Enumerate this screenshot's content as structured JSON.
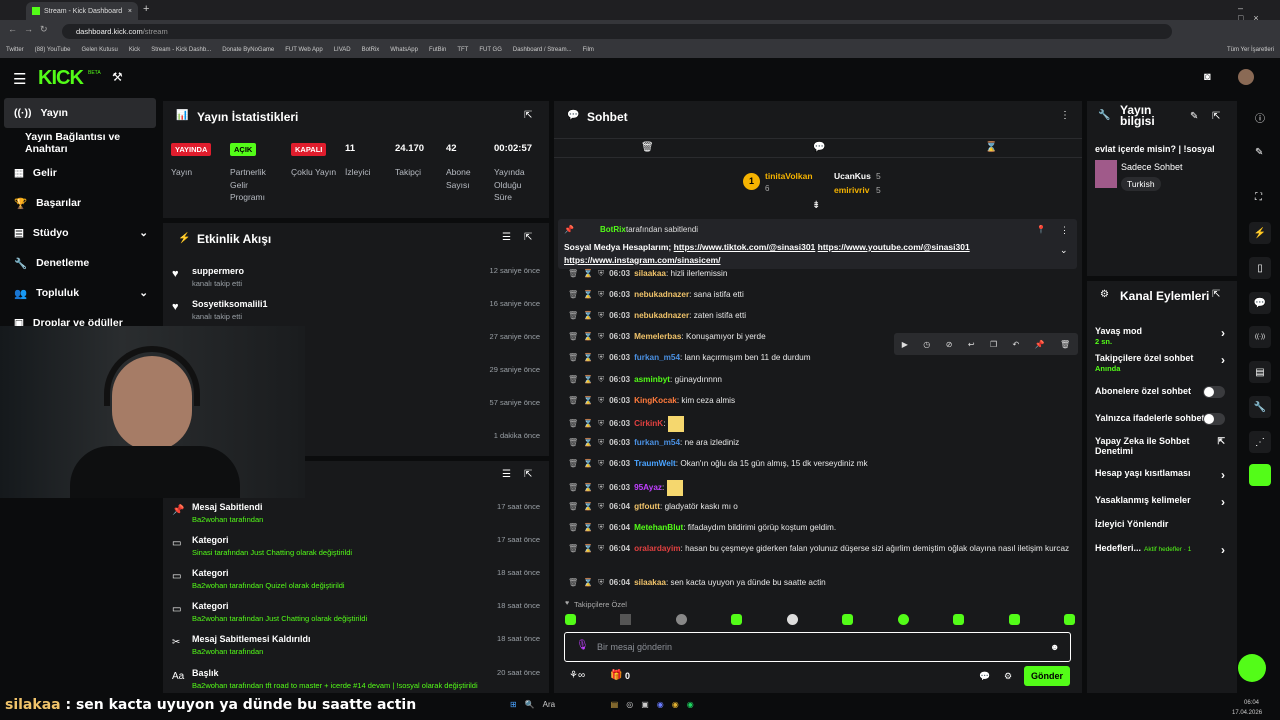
{
  "browser": {
    "tab_title": "Stream - Kick Dashboard",
    "url_host": "dashboard.kick.com",
    "url_path": "/stream",
    "bookmarks": [
      "Twitter",
      "(88) YouTube",
      "Gelen Kutusu",
      "Kick",
      "Stream - Kick Dashb...",
      "Donate ByNoGame",
      "FUT Web App",
      "LIVAD",
      "BotRix",
      "WhatsApp",
      "FutBin",
      "TFT",
      "FUT GG",
      "Dashboard / Stream...",
      "Film"
    ],
    "all_bookmarks": "Tüm Yer İşaretleri"
  },
  "logo": "KICK",
  "logo_sup": "BETA",
  "sidebar": {
    "items": [
      {
        "label": "Yayın",
        "icon": "broadcast-icon"
      },
      {
        "label": "Yayın Bağlantısı ve Anahtarı"
      },
      {
        "label": "Gelir",
        "icon": "chart-icon"
      },
      {
        "label": "Başarılar",
        "icon": "trophy-icon"
      },
      {
        "label": "Stüdyo",
        "icon": "grid-icon"
      },
      {
        "label": "Denetleme",
        "icon": "wrench-icon"
      },
      {
        "label": "Topluluk",
        "icon": "people-icon"
      },
      {
        "label": "Droplar ve ödüller",
        "icon": "drops-icon"
      }
    ]
  },
  "stats": {
    "title": "Yayın İstatistikleri",
    "items": [
      {
        "badge": "YAYINDA",
        "badge_color": "#e01d2d",
        "label": "Yayın"
      },
      {
        "badge": "AÇIK",
        "badge_color": "#53fc18",
        "label": "Partnerlik Gelir Programı"
      },
      {
        "badge": "KAPALI",
        "badge_color": "#e01d2d",
        "label": "Çoklu Yayın"
      },
      {
        "value": "11",
        "label": "İzleyici"
      },
      {
        "value": "24.170",
        "label": "Takipçi"
      },
      {
        "value": "42",
        "label": "Abone Sayısı"
      },
      {
        "value": "00:02:57",
        "label": "Yayında Olduğu Süre"
      }
    ]
  },
  "activity": {
    "title": "Etkinlik Akışı",
    "items": [
      {
        "name": "suppermero",
        "sub": "kanalı takip etti",
        "time": "12 saniye önce"
      },
      {
        "name": "Sosyetiksomalili1",
        "sub": "kanalı takip etti",
        "time": "16 saniye önce"
      },
      {
        "time": "27 saniye önce"
      },
      {
        "time": "29 saniye önce"
      },
      {
        "time": "57 saniye önce"
      },
      {
        "time": "1 dakika önce"
      }
    ]
  },
  "modlog": {
    "items": [
      {
        "title": "Mesaj Sabitlendi",
        "sub": "Ba2wohan tarafından",
        "time": "17 saat önce"
      },
      {
        "title": "Kategori",
        "sub": "Sinasi tarafından Just Chatting olarak değiştirildi",
        "time": "17 saat önce"
      },
      {
        "title": "Kategori",
        "sub": "Ba2wohan tarafından Quizel olarak değiştirildi",
        "time": "18 saat önce"
      },
      {
        "title": "Kategori",
        "sub": "Ba2wohan tarafından Just Chatting olarak değiştirildi",
        "time": "18 saat önce"
      },
      {
        "title": "Mesaj Sabitlemesi Kaldırıldı",
        "sub": "Ba2wohan tarafından",
        "time": "18 saat önce"
      },
      {
        "title": "Başlık",
        "sub": "Ba2wohan tarafından tft road to master + icerde #14 devam | !sosyal olarak değiştirildi",
        "time": "20 saat önce"
      }
    ]
  },
  "chat": {
    "title": "Sohbet",
    "leaders": [
      {
        "name": "tinitaVolkan",
        "count": "6",
        "rank": "1"
      },
      {
        "name": "UcanKus",
        "count": "5"
      },
      {
        "name": "emirivriv",
        "count": "5"
      }
    ],
    "pinned": {
      "by": "BotRix",
      "by_suffix": "tarafından sabitlendi",
      "text": "Sosyal Medya Hesaplarım;",
      "links": [
        "https://www.tiktok.com/@sinasi301",
        "https://www.youtube.com/@sinasi301",
        "https://www.instagram.com/sinasicem/"
      ]
    },
    "messages": [
      {
        "time": "06:03",
        "user": "silaakaa",
        "color": "#f0c36a",
        "text": "hizli ilerlemissin"
      },
      {
        "time": "06:03",
        "user": "nebukadnazer",
        "color": "#f0c36a",
        "text": "sana istifa etti"
      },
      {
        "time": "06:03",
        "user": "nebukadnazer",
        "color": "#f0c36a",
        "text": "zaten istifa etti"
      },
      {
        "time": "06:03",
        "user": "Memelerbas",
        "color": "#f0c36a",
        "text": "Konuşamıyor bi yerde"
      },
      {
        "time": "06:03",
        "user": "furkan_m54",
        "color": "#4a90e2",
        "text": "lann kaçırmışım ben 11 de durdum"
      },
      {
        "time": "06:03",
        "user": "asminbyt",
        "color": "#53fc18",
        "text": "günaydınnnn"
      },
      {
        "time": "06:03",
        "user": "KingKocak",
        "color": "#ff7a3c",
        "text": "kim ceza almis"
      },
      {
        "time": "06:03",
        "user": "CirkinK",
        "color": "#e04040",
        "text": ""
      },
      {
        "time": "06:03",
        "user": "furkan_m54",
        "color": "#4a90e2",
        "text": "ne ara izlediniz"
      },
      {
        "time": "06:03",
        "user": "TraumWelt",
        "color": "#4aa3ff",
        "text": "Okan'ın oğlu da 15 gün almış, 15 dk verseydiniz mk"
      },
      {
        "time": "06:03",
        "user": "95Ayaz",
        "color": "#c040ff",
        "text": ""
      },
      {
        "time": "06:04",
        "user": "gtfoutt",
        "color": "#f0c36a",
        "text": "gladyatör kaskı mı o"
      },
      {
        "time": "06:04",
        "user": "MetehanBlut",
        "color": "#53fc18",
        "text": "fifadaydım bildirimi görüp koştum geldim."
      },
      {
        "time": "06:04",
        "user": "oralardayim",
        "color": "#e04040",
        "text": "hasan bu çeşmeye giderken falan yolunuz düşerse sizi ağırlim demiştim oğlak olayına nasıl iletişim kurcaz"
      },
      {
        "time": "06:04",
        "user": "silaakaa",
        "color": "#f0c36a",
        "text": "sen kacta uyuyon ya dünde bu saatte actin"
      }
    ],
    "follower_only": "Takipçilere Özel",
    "placeholder": "Bir mesaj gönderin",
    "send_label": "Gönder",
    "count": "0"
  },
  "stream_info": {
    "title": "Yayın bilgisi",
    "stream_title": "evlat içerde misin? | !sosyal",
    "category": "Sadece Sohbet",
    "tag": "Turkish"
  },
  "channel": {
    "title": "Kanal Eylemleri",
    "items": [
      {
        "label": "Yavaş mod",
        "sub": "2 sn.",
        "type": "arrow"
      },
      {
        "label": "Takipçilere özel sohbet",
        "sub": "Anında",
        "type": "arrow"
      },
      {
        "label": "Abonelere özel sohbet",
        "type": "toggle"
      },
      {
        "label": "Yalnızca ifadelerle sohbet",
        "type": "toggle"
      },
      {
        "label": "Yapay Zeka ile Sohbet Denetimi",
        "type": "ext"
      },
      {
        "label": "Hesap yaşı kısıtlaması",
        "type": "arrow"
      },
      {
        "label": "Yasaklanmış kelimeler",
        "type": "arrow"
      },
      {
        "label": "İzleyici Yönlendir",
        "type": "none"
      },
      {
        "label": "Hedefleri...",
        "sub": "Aktif hedefler · 1",
        "type": "arrow"
      }
    ]
  },
  "overlay_caption": {
    "user": "silakaa",
    "text": "sen kacta uyuyon ya dünde bu saatte actin"
  },
  "taskbar": {
    "search": "Ara",
    "time": "06:04",
    "date": "17.04.2026"
  },
  "colors": {
    "kick_green": "#53fc18",
    "panel": "#18191b",
    "bg": "#0b0c0d"
  }
}
